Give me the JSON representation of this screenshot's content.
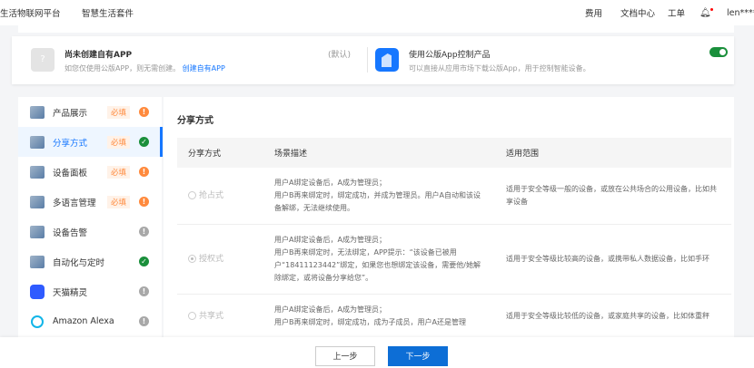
{
  "header": {
    "left": [
      "生活物联网平台",
      "智慧生活套件"
    ],
    "right": [
      "费用",
      "文档中心",
      "工单"
    ],
    "user": "len****"
  },
  "app_card": {
    "left_title": "尚未创建自有APP",
    "left_desc": "如您仅使用公版APP，则无需创建。",
    "left_link": "创建自有APP",
    "default_label": "(默认)",
    "right_title": "使用公版App控制产品",
    "right_desc": "可以直接从应用市场下载公版App，用于控制智能设备。",
    "toggle_on": true
  },
  "sidebar": {
    "required_label": "必填",
    "items": [
      {
        "label": "产品展示",
        "required": true,
        "status": "warn"
      },
      {
        "label": "分享方式",
        "required": true,
        "status": "ok"
      },
      {
        "label": "设备面板",
        "required": true,
        "status": "warn"
      },
      {
        "label": "多语言管理",
        "required": true,
        "status": "warn"
      },
      {
        "label": "设备告警",
        "required": false,
        "status": "gray"
      },
      {
        "label": "自动化与定时",
        "required": false,
        "status": "ok"
      },
      {
        "label": "天猫精灵",
        "required": false,
        "status": "gray"
      },
      {
        "label": "Amazon Alexa",
        "required": false,
        "status": "gray"
      }
    ]
  },
  "main": {
    "title": "分享方式",
    "columns": [
      "分享方式",
      "场景描述",
      "适用范围"
    ],
    "rows": [
      {
        "mode": "抢占式",
        "selected": false,
        "desc1": "用户A绑定设备后，A成为管理员；",
        "desc2": "用户B再来绑定时，绑定成功，并成为管理员。用户A自动和该设备解绑，无法继续使用。",
        "scope": "适用于安全等级一般的设备，或放在公共场合的公用设备，比如共享设备"
      },
      {
        "mode": "授权式",
        "selected": true,
        "desc1": "用户A绑定设备后，A成为管理员；",
        "desc2": "用户B再来绑定时，无法绑定，APP提示：“该设备已被用户“18411123442”绑定，如果您也想绑定该设备，需要他/她解除绑定，或将设备分享给您”。",
        "scope": "适用于安全等级比较高的设备，或携带私人数据设备，比如手环"
      },
      {
        "mode": "共享式",
        "selected": false,
        "desc1": "用户A绑定设备后，A成为管理员；",
        "desc2": "用户B再来绑定时，绑定成功，成为子成员，用户A还是管理",
        "scope": "适用于安全等级比较低的设备，或家庭共享的设备，比如体重秤"
      }
    ]
  },
  "footer": {
    "prev": "上一步",
    "next": "下一步"
  }
}
